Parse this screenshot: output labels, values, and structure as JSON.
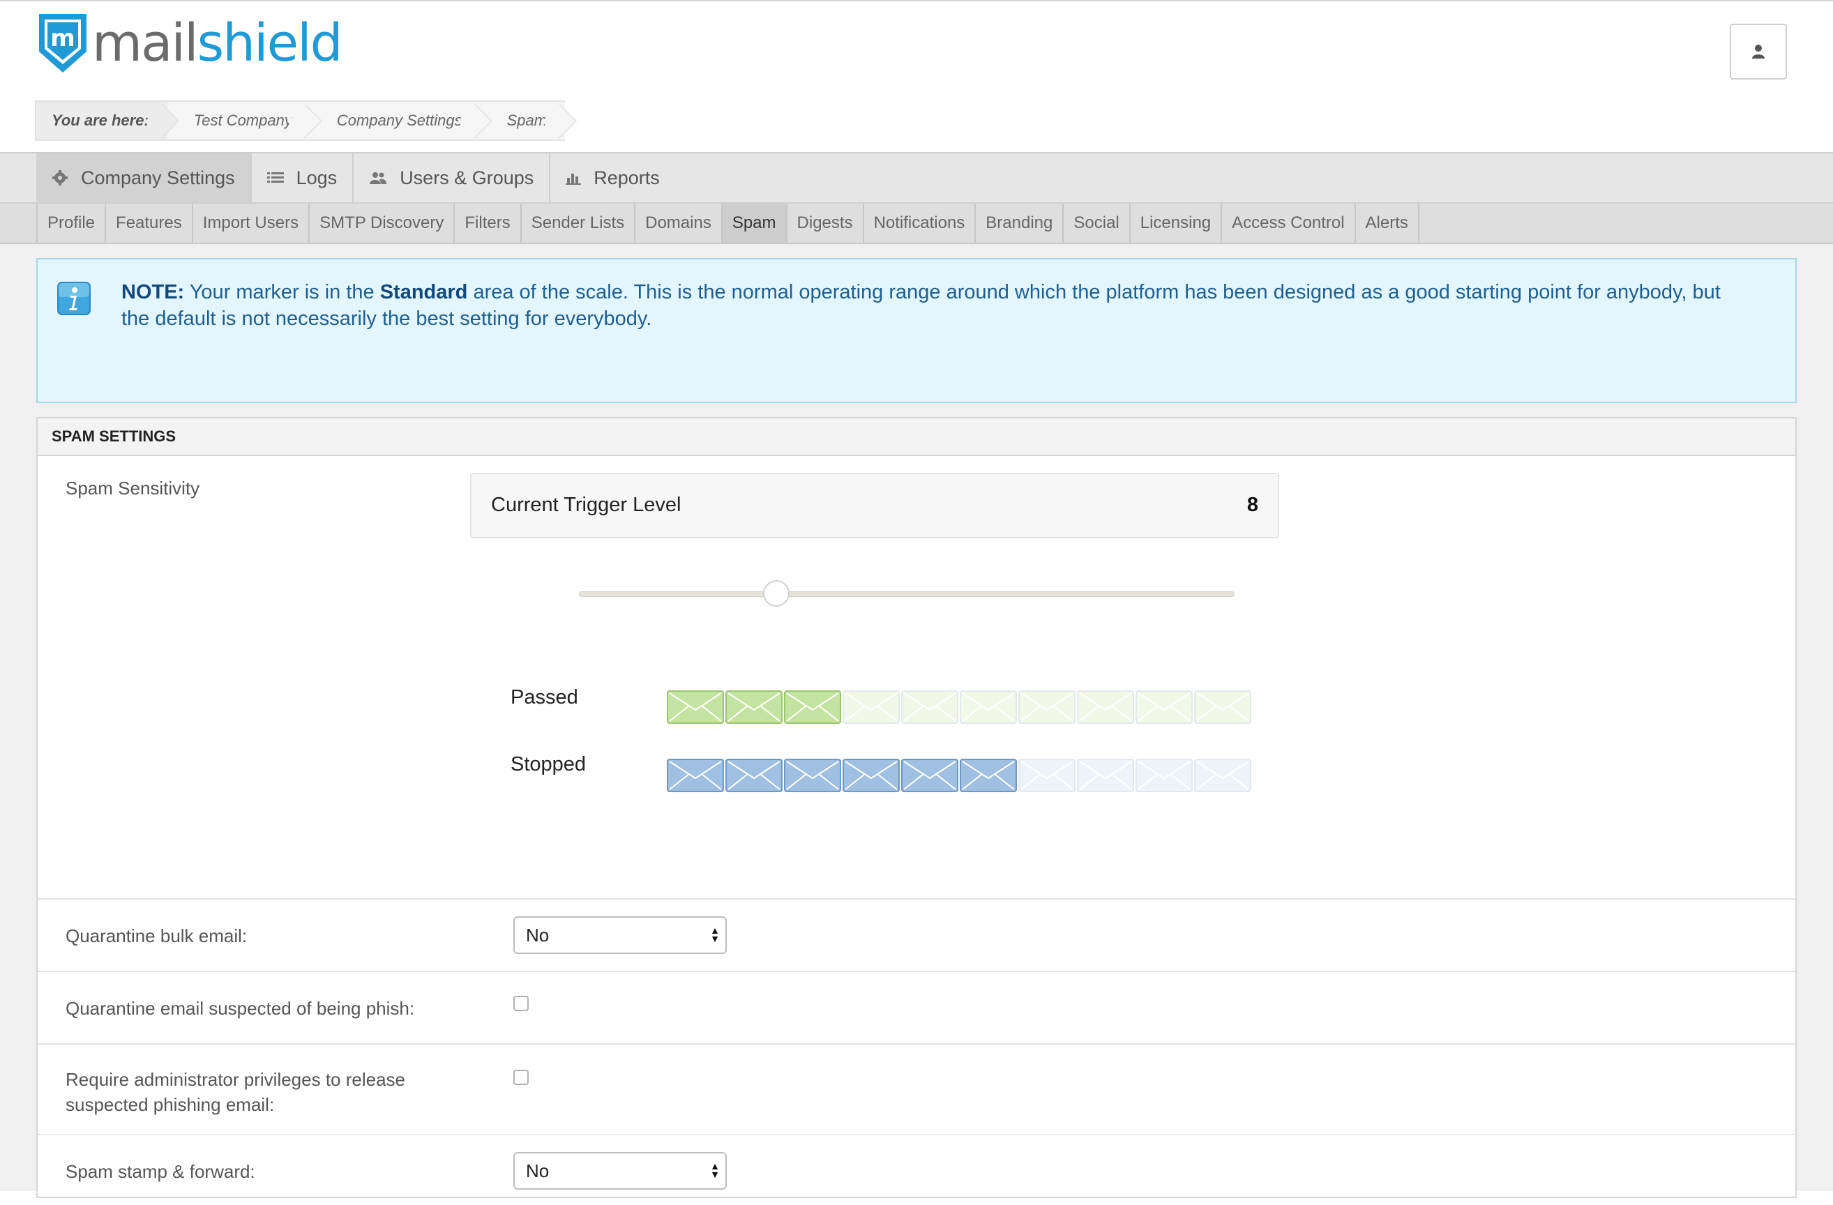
{
  "brand": {
    "logo_mark": "m",
    "logo_part1": "mail",
    "logo_part2": "shield",
    "accent": "#1f9ad6"
  },
  "header": {
    "user_icon": "user-icon"
  },
  "breadcrumb": [
    "You are here:",
    "Test Company",
    "Company Settings",
    "Spam"
  ],
  "main_nav": [
    {
      "label": "Company Settings",
      "icon": "gear-icon",
      "active": true
    },
    {
      "label": "Logs",
      "icon": "list-icon",
      "active": false
    },
    {
      "label": "Users & Groups",
      "icon": "users-icon",
      "active": false
    },
    {
      "label": "Reports",
      "icon": "bar-chart-icon",
      "active": false
    }
  ],
  "sub_nav": [
    "Profile",
    "Features",
    "Import Users",
    "SMTP Discovery",
    "Filters",
    "Sender Lists",
    "Domains",
    "Spam",
    "Digests",
    "Notifications",
    "Branding",
    "Social",
    "Licensing",
    "Access Control",
    "Alerts"
  ],
  "sub_nav_active": "Spam",
  "note": {
    "prefix": "NOTE:",
    "text1": " Your marker is in the ",
    "highlight": "Standard",
    "text2": " area of the scale. This is the normal operating range around which the platform has been designed as a good starting point for anybody, but the default is not necessarily the best setting for everybody."
  },
  "spam_settings": {
    "title": "SPAM SETTINGS",
    "sensitivity_label": "Spam Sensitivity",
    "trigger_label": "Current Trigger Level",
    "trigger_value": "8",
    "slider_fraction": 0.3,
    "passed_label": "Passed",
    "passed_filled": 3,
    "stopped_label": "Stopped",
    "stopped_filled": 6,
    "total_envelopes": 10,
    "passed_color": "#c5e3a0",
    "stopped_color": "#9fc0e0",
    "quarantine_bulk_label": "Quarantine bulk email:",
    "quarantine_bulk_value": "No",
    "quarantine_phish_label": "Quarantine email suspected of being phish:",
    "admin_release_label": "Require administrator privileges to release suspected phishing email:",
    "stamp_forward_label": "Spam stamp & forward:",
    "stamp_forward_value": "No"
  }
}
